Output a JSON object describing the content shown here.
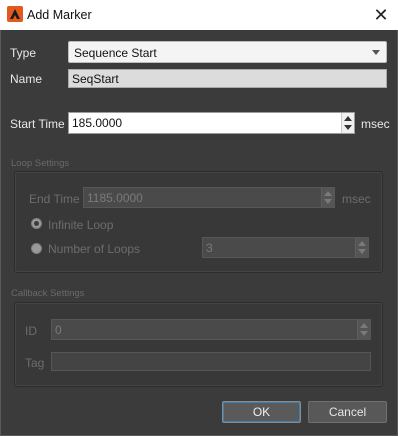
{
  "window": {
    "title": "Add Marker"
  },
  "fields": {
    "type_label": "Type",
    "type_value": "Sequence Start",
    "name_label": "Name",
    "name_value": "SeqStart",
    "start_time_label": "Start Time",
    "start_time_value": "185.0000",
    "start_time_unit": "msec"
  },
  "loop_settings": {
    "title": "Loop Settings",
    "end_time_label": "End Time",
    "end_time_value": "1185.0000",
    "end_time_unit": "msec",
    "infinite_loop_label": "Infinite Loop",
    "infinite_loop_selected": true,
    "number_of_loops_label": "Number of Loops",
    "number_of_loops_value": "3"
  },
  "callback_settings": {
    "title": "Callback Settings",
    "id_label": "ID",
    "id_value": "0",
    "tag_label": "Tag",
    "tag_value": ""
  },
  "buttons": {
    "ok": "OK",
    "cancel": "Cancel"
  },
  "colors": {
    "dialog_bg": "#3b3b3b",
    "accent": "#3c7fb1",
    "app_icon": "#e25a1c"
  }
}
